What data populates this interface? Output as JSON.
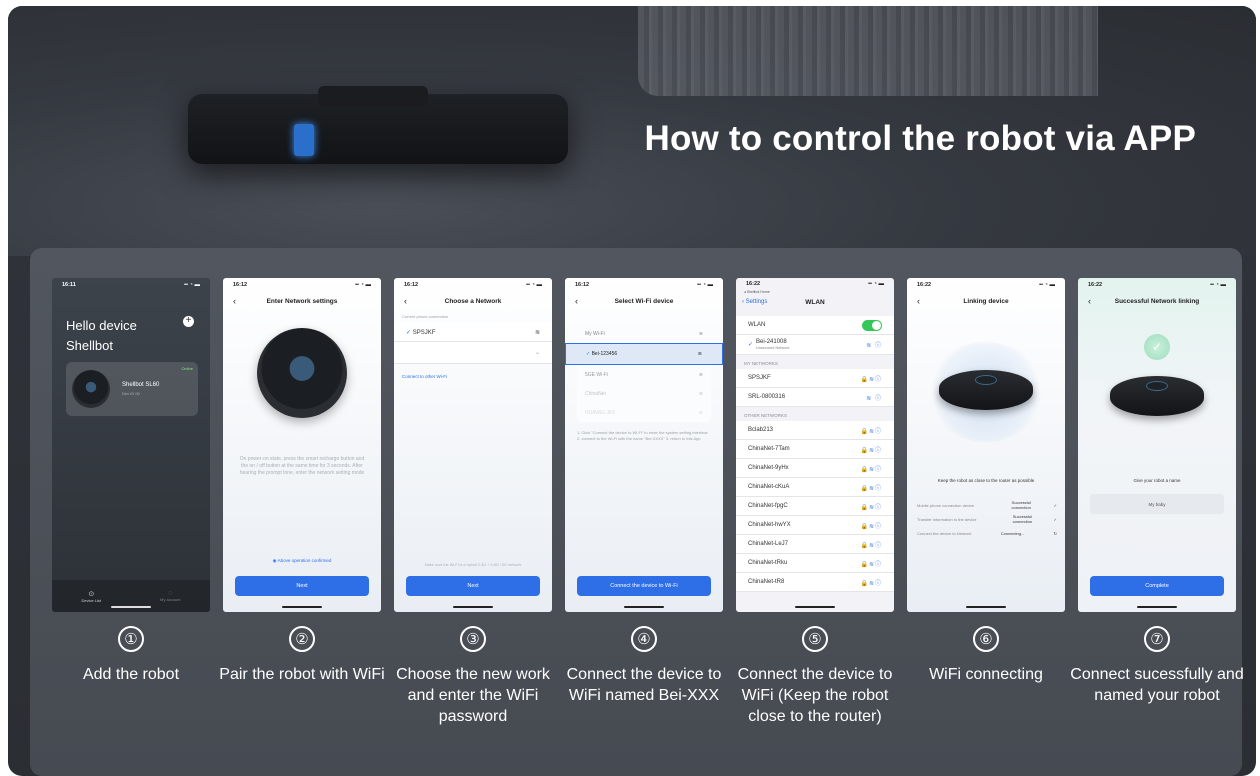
{
  "headline": "How to control the robot via APP",
  "steps": [
    {
      "num": "①",
      "caption": "Add the robot",
      "screen": {
        "time": "16:11",
        "hello": "Hello device",
        "brand": "Shellbot",
        "card_name": "Shellbot SL60",
        "card_sub": "Dev ID 00",
        "badge": "Online",
        "tab1": "Device List",
        "tab2": "My account"
      }
    },
    {
      "num": "②",
      "caption": "Pair the robot with WiFi",
      "screen": {
        "time": "16:12",
        "title": "Enter Network settings",
        "body": "On power-on state, press the smart recharge button and the on / off button at the same time for 3 seconds. After hearing the prompt tone, enter the network setting mode",
        "confirm": "Above operation confirmed",
        "button": "Next"
      }
    },
    {
      "num": "③",
      "caption": "Choose the new work and enter the WiFi password",
      "screen": {
        "time": "16:12",
        "title": "Choose a Network",
        "hint": "Current phone connection",
        "network": "SPSJKF",
        "other": "Connect to other Wi-Fi",
        "note": "Make sure the Wi-Fi is a hybrid 2.4G + 5.8G / 5G network",
        "button": "Next"
      }
    },
    {
      "num": "④",
      "caption": "Connect the device to WiFi named Bei-XXX",
      "screen": {
        "time": "16:12",
        "title": "Select Wi-Fi device",
        "items": [
          "My Wi-Fi",
          "Bei-123456",
          "5GE Wi-Fi",
          "ChinaNet",
          "HUAWEI-JKF"
        ],
        "selected": "Bei-123456",
        "steps_text": "1. Click \"Connect the device to Wi-Fi\" to enter the system setting interface 2. connect to the Wi-Fi with the name \"Bei-XXXX\" 3. return to this App",
        "button": "Connect the device to Wi-Fi"
      }
    },
    {
      "num": "⑤",
      "caption": "Connect the device to WiFi (Keep the robot close to the router)",
      "screen": {
        "time": "16:22",
        "back_app": "◂ Shellbot Home",
        "settings": "Settings",
        "title": "WLAN",
        "wlan": "WLAN",
        "current": "Bei-241008",
        "current_sub": "Unsecured Network",
        "my_networks": "MY NETWORKS",
        "mine": [
          "SPSJKF",
          "SRL-0800316"
        ],
        "other_networks": "OTHER NETWORKS",
        "others": [
          "Bclab213",
          "ChinaNet-7Tam",
          "ChinaNet-9yHx",
          "ChinaNet-cKuA",
          "ChinaNet-fpgC",
          "ChinaNet-hwYX",
          "ChinaNet-LeJ7",
          "ChinaNet-tRku",
          "ChinaNet-tR8"
        ]
      }
    },
    {
      "num": "⑥",
      "caption": "WiFi connecting",
      "screen": {
        "time": "16:22",
        "title": "Linking device",
        "hint": "Keep the robot as close to the router as possible",
        "rows": [
          {
            "label": "Mobile phone connection device",
            "status": "Successful connection"
          },
          {
            "label": "Transfer information to the device",
            "status": "Successful connection"
          },
          {
            "label": "Connect the device to Network",
            "status": "Connecting..."
          }
        ]
      }
    },
    {
      "num": "⑦",
      "caption": "Connect sucessfully and named your robot",
      "screen": {
        "time": "16:22",
        "title": "Successful Network linking",
        "prompt": "Give your robot a name",
        "name_value": "My baby",
        "button": "Complete"
      }
    }
  ]
}
